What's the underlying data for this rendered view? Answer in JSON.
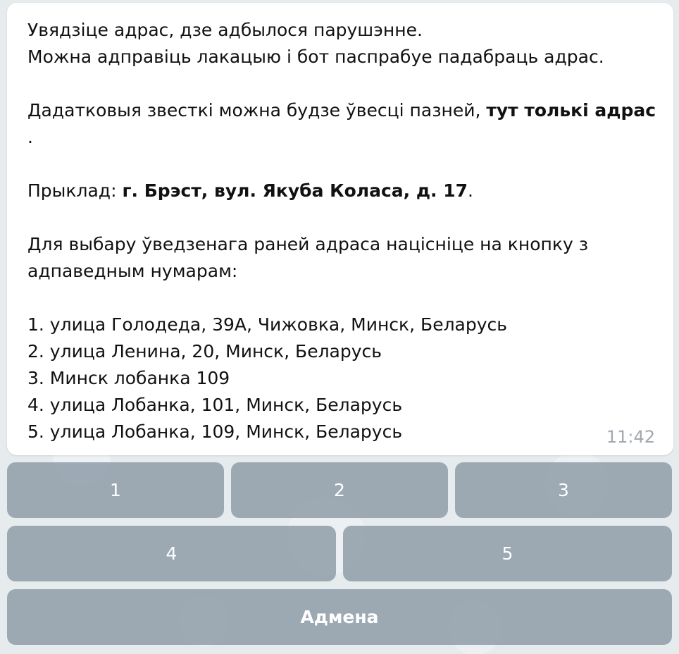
{
  "message": {
    "line1": "Увядзіце адрас, дзе адбылося парушэнне.",
    "line2": "Можна адправіць лакацыю і бот паспрабуе падабраць адрас.",
    "line3_prefix": "Дадатковыя звесткі можна будзе ўвесці пазней, ",
    "line3_bold": "тут толькі адрас",
    "line4": ".",
    "example_label": "Прыклад:  ",
    "example_value": "г. Брэст, вул. Якуба Коласа, д. 17",
    "example_suffix": ".",
    "choose_line1": "Для выбару ўведзенага раней адраса націсніце на кнопку з",
    "choose_line2": "адпаведным нумарам:",
    "addresses": [
      "1. улица Голодеда, 39А, Чижовка, Минск, Беларусь",
      "2. улица Ленина, 20, Минск, Беларусь",
      "3. Минск лобанка 109",
      "4. улица Лобанка, 101, Минск, Беларусь",
      "5. улица Лобанка, 109, Минск, Беларусь"
    ],
    "time": "11:42"
  },
  "keyboard": {
    "row1": [
      "1",
      "2",
      "3"
    ],
    "row2": [
      "4",
      "5"
    ],
    "cancel": "Адмена"
  }
}
